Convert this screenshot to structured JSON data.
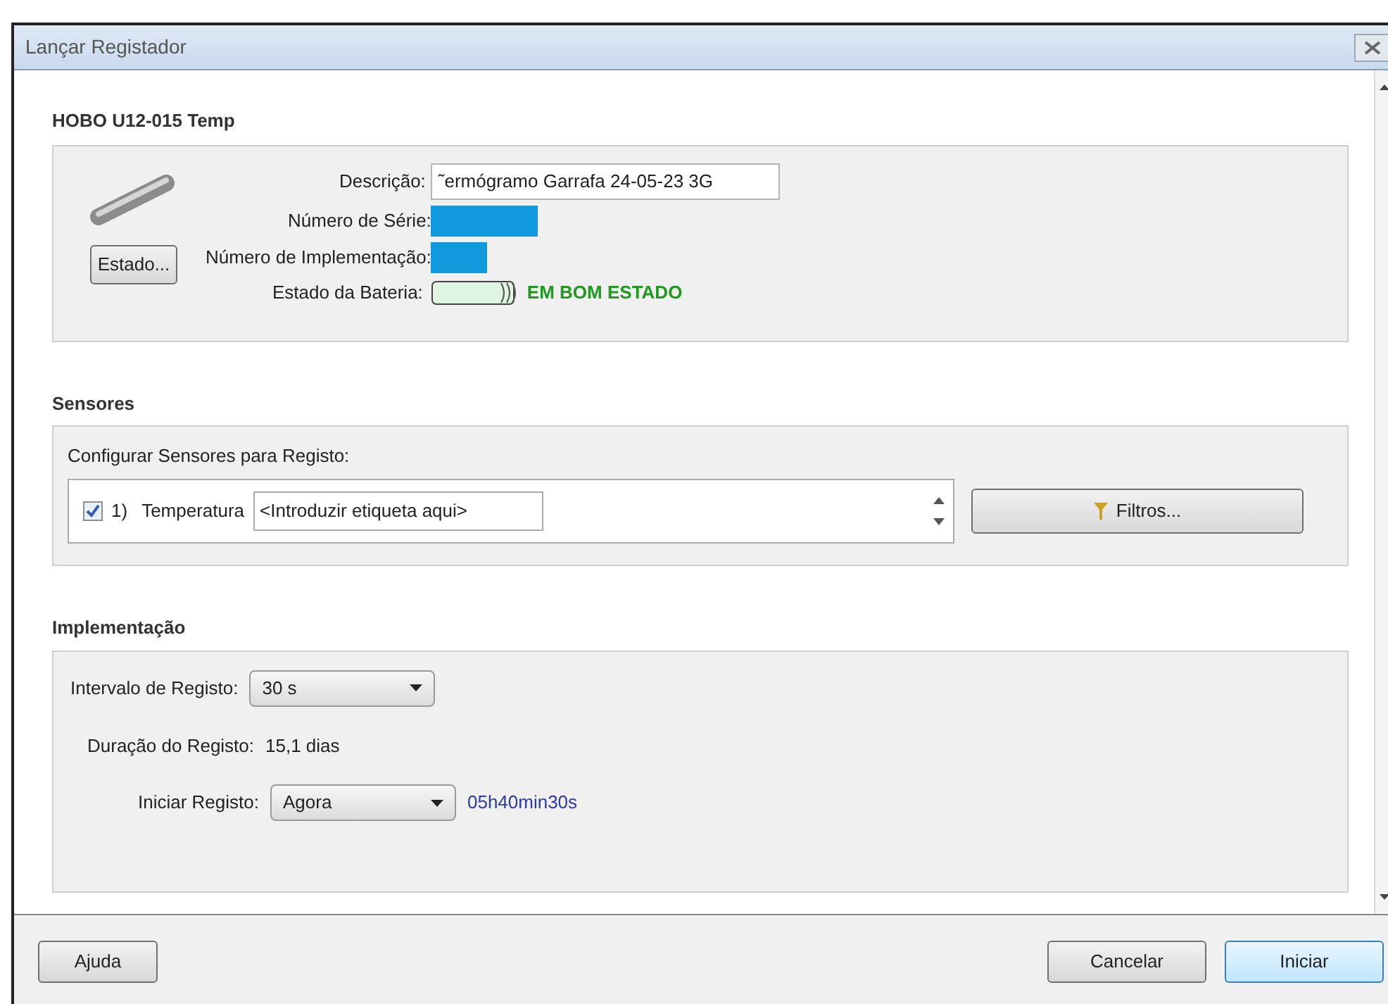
{
  "window": {
    "title": "Lançar Registador"
  },
  "device": {
    "heading": "HOBO U12-015 Temp",
    "status_button": "Estado...",
    "description_label": "Descrição:",
    "description_value": "˜ermógramo Garrafa 24-05-23 3G",
    "serial_label": "Número de Série:",
    "deployment_label": "Número de Implementação:",
    "battery_label": "Estado da Bateria:",
    "battery_status": "EM BOM ESTADO"
  },
  "sensors": {
    "heading": "Sensores",
    "caption": "Configurar Sensores para Registo:",
    "items": [
      {
        "index": "1)",
        "name": "Temperatura",
        "label_value": "<Introduzir etiqueta aqui>",
        "checked": true
      }
    ],
    "filters_button": "Filtros..."
  },
  "deployment": {
    "heading": "Implementação",
    "interval_label": "Intervalo de Registo:",
    "interval_value": "30 s",
    "duration_label": "Duração do Registo:",
    "duration_value": "15,1 dias",
    "start_label": "Iniciar Registo:",
    "start_value": "Agora",
    "start_time": "05h40min30s"
  },
  "buttons": [
    {
      "label": "Ajuda",
      "kind": "help"
    },
    {
      "label": "Cancelar",
      "kind": "cancel"
    },
    {
      "label": "Iniciar",
      "kind": "primary"
    }
  ]
}
